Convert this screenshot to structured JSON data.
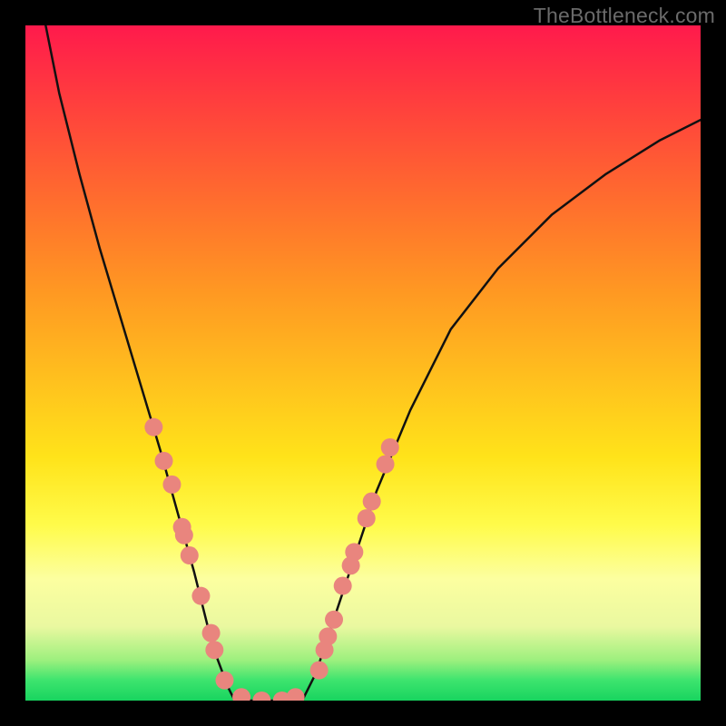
{
  "watermark_text": "TheBottleneck.com",
  "chart_data": {
    "type": "line",
    "title": "",
    "xlabel": "",
    "ylabel": "",
    "xlim": [
      0,
      100
    ],
    "ylim": [
      0,
      100
    ],
    "grid": false,
    "annotations": [],
    "series": [
      {
        "name": "curve",
        "x": [
          3,
          5,
          8,
          11,
          14,
          17,
          20,
          22.5,
          25,
          27,
          28.5,
          30,
          31,
          41,
          43,
          45,
          48,
          52,
          57,
          63,
          70,
          78,
          86,
          94,
          100
        ],
        "y": [
          100,
          90,
          78,
          67,
          57,
          47,
          37,
          28,
          19,
          11,
          6,
          2,
          0,
          0,
          4,
          10,
          19,
          31,
          43,
          55,
          64,
          72,
          78,
          83,
          86
        ],
        "stroke": "#111111",
        "stroke_width": 2.5
      }
    ],
    "flat_bottom": {
      "x_start": 31,
      "x_end": 41,
      "y": 0
    },
    "markers": {
      "color": "#e9857e",
      "radius": 10,
      "points": [
        {
          "x": 19.0,
          "y": 40.5
        },
        {
          "x": 20.5,
          "y": 35.5
        },
        {
          "x": 21.7,
          "y": 32.0
        },
        {
          "x": 23.5,
          "y": 24.5
        },
        {
          "x": 23.2,
          "y": 25.7
        },
        {
          "x": 24.3,
          "y": 21.5
        },
        {
          "x": 26.0,
          "y": 15.5
        },
        {
          "x": 27.5,
          "y": 10.0
        },
        {
          "x": 28.0,
          "y": 7.5
        },
        {
          "x": 29.5,
          "y": 3.0
        },
        {
          "x": 32.0,
          "y": 0.5
        },
        {
          "x": 35.0,
          "y": 0.0
        },
        {
          "x": 38.0,
          "y": 0.0
        },
        {
          "x": 40.0,
          "y": 0.5
        },
        {
          "x": 43.5,
          "y": 4.5
        },
        {
          "x": 44.3,
          "y": 7.5
        },
        {
          "x": 44.8,
          "y": 9.5
        },
        {
          "x": 45.7,
          "y": 12.0
        },
        {
          "x": 47.0,
          "y": 17.0
        },
        {
          "x": 48.2,
          "y": 20.0
        },
        {
          "x": 48.7,
          "y": 22.0
        },
        {
          "x": 50.5,
          "y": 27.0
        },
        {
          "x": 51.3,
          "y": 29.5
        },
        {
          "x": 53.3,
          "y": 35.0
        },
        {
          "x": 54.0,
          "y": 37.5
        }
      ]
    }
  }
}
